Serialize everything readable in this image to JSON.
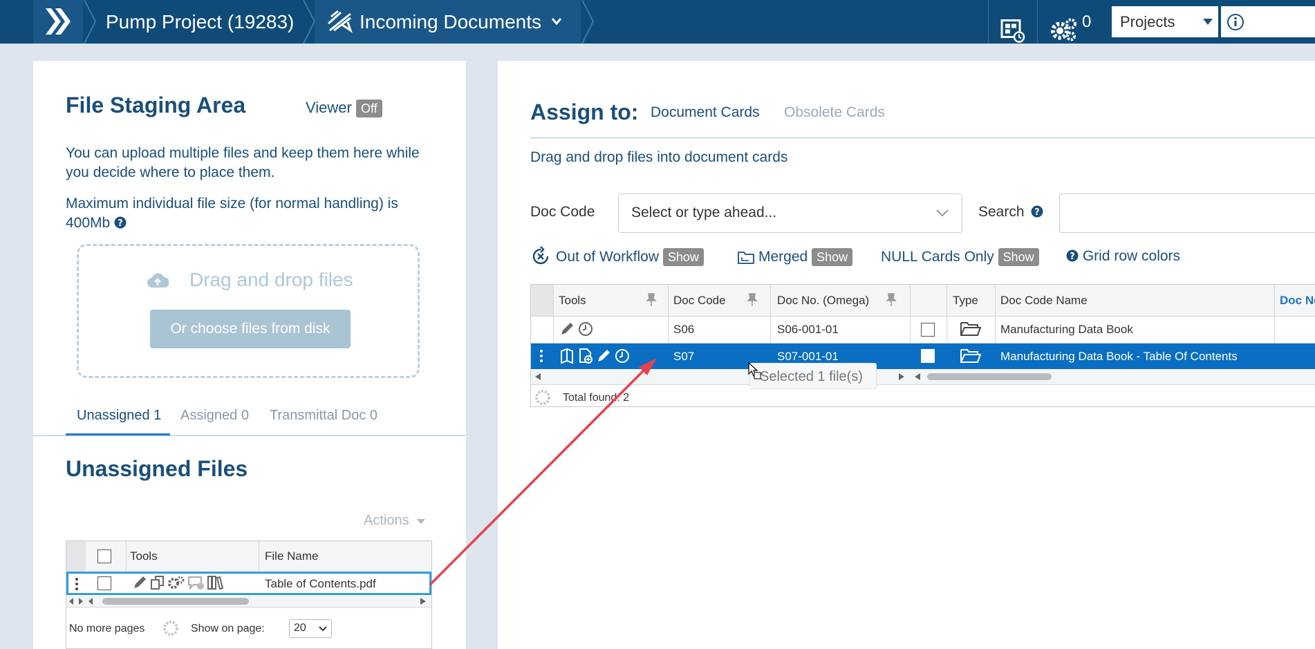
{
  "topbar": {
    "project": "Pump Project (19283)",
    "module": "Incoming Documents",
    "queue_count": "0",
    "projects_select": "Projects"
  },
  "staging": {
    "title": "File Staging Area",
    "viewer_label": "Viewer",
    "viewer_state": "Off",
    "desc1": "You can upload multiple files and keep them here while you decide where to place them.",
    "desc2": "Maximum individual file size (for normal handling) is 400Mb",
    "drop_label": "Drag and drop files",
    "choose_button": "Or choose files from disk",
    "tabs": [
      "Unassigned 1",
      "Assigned 0",
      "Transmittal Doc 0"
    ],
    "unassigned_title": "Unassigned Files",
    "actions_label": "Actions",
    "file_grid": {
      "headers": [
        "Tools",
        "File Name"
      ],
      "rows": [
        {
          "file_name": "Table of Contents.pdf"
        }
      ]
    },
    "footer": {
      "no_more": "No more pages",
      "show_on_page": "Show on page:",
      "page_size": "20"
    }
  },
  "assign": {
    "title": "Assign to:",
    "tabs": [
      "Document Cards",
      "Obsolete Cards"
    ],
    "hint": "Drag and drop files into document cards",
    "doc_code_label": "Doc Code",
    "doc_code_placeholder": "Select or type ahead...",
    "search_label": "Search",
    "filters": [
      {
        "label": "Out of Workflow",
        "button": "Show"
      },
      {
        "label": "Merged",
        "button": "Show"
      },
      {
        "label": "NULL Cards Only",
        "button": "Show"
      },
      {
        "label": "Grid row colors"
      }
    ],
    "grid": {
      "headers": [
        "Tools",
        "Doc Code",
        "Doc No. (Omega)",
        "Type",
        "Doc Code Name",
        "Doc Ne"
      ],
      "rows": [
        {
          "doc_code": "S06",
          "doc_no": "S06-001-01",
          "name": "Manufacturing Data Book"
        },
        {
          "doc_code": "S07",
          "doc_no": "S07-001-01",
          "name": "Manufacturing Data Book - Table Of Contents"
        }
      ],
      "total": "Total found: 2"
    },
    "drag_tooltip": "Selected 1 file(s)"
  },
  "colors": {
    "topbar": "#0f4b79",
    "selected_row": "#0a6fc2",
    "accent": "#1b4f7a",
    "arrow": "#e5424d"
  }
}
